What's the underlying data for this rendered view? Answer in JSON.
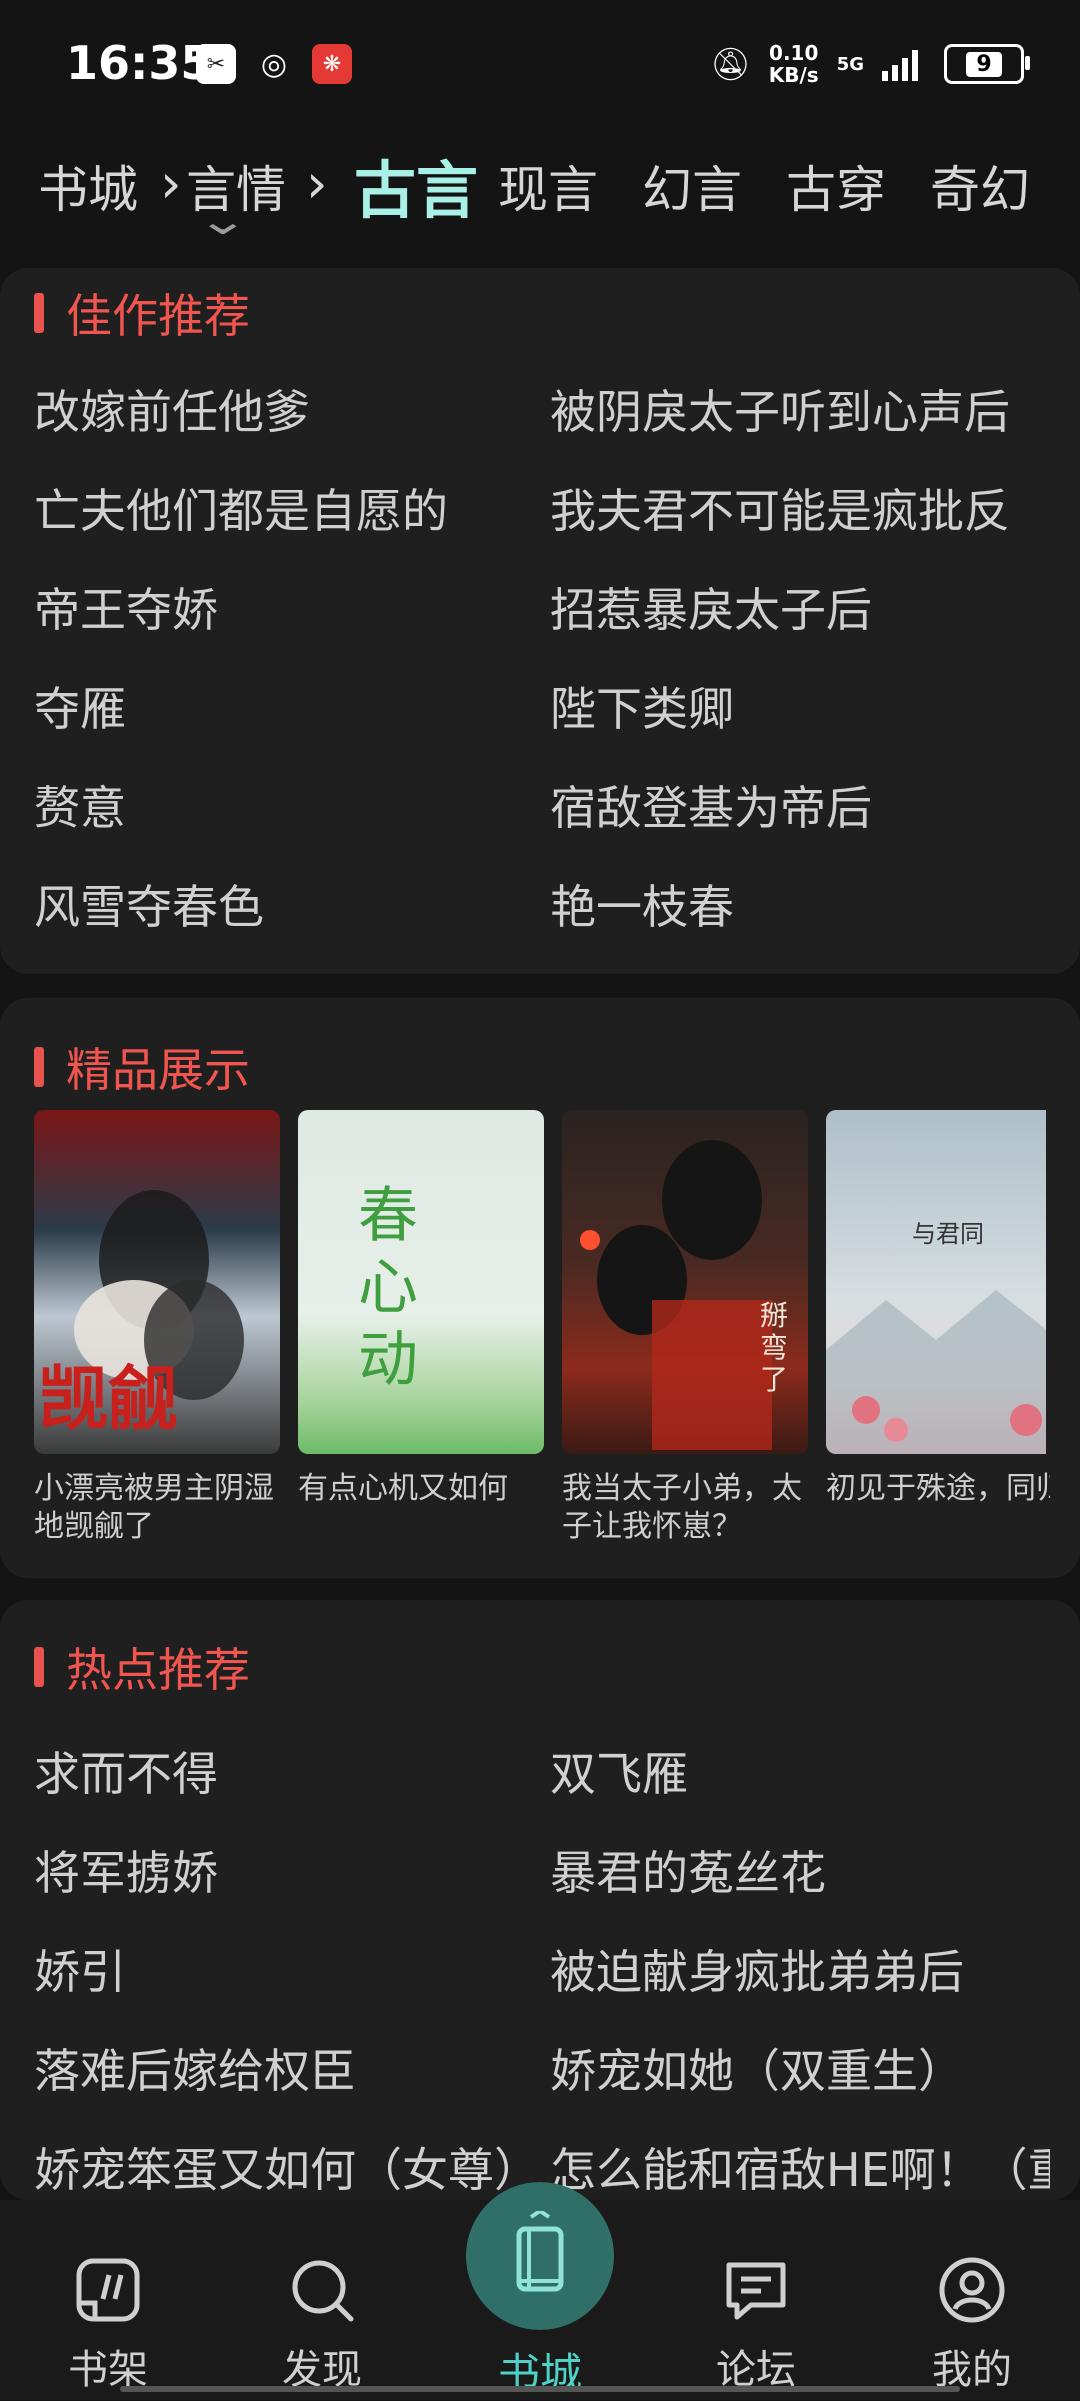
{
  "status_bar": {
    "time": "16:35",
    "net_speed_value": "0.10",
    "net_speed_unit": "KB/s",
    "network": "5G",
    "battery": "9"
  },
  "category_tabs": [
    {
      "label": "书城"
    },
    {
      "label": "言情"
    },
    {
      "label": "古言",
      "active": true
    },
    {
      "label": "现言"
    },
    {
      "label": "幻言"
    },
    {
      "label": "古穿"
    },
    {
      "label": "奇幻"
    }
  ],
  "sections": {
    "featured": {
      "title": "佳作推荐",
      "items": [
        "改嫁前任他爹",
        "被阴戾太子听到心声后",
        "亡夫他们都是自愿的",
        "我夫君不可能是疯批反",
        "帝王夺娇",
        "招惹暴戾太子后",
        "夺雁",
        "陛下类卿",
        "赘意",
        "宿敌登基为帝后",
        "风雪夺春色",
        "艳一枝春"
      ]
    },
    "premium": {
      "title": "精品展示",
      "books": [
        {
          "title": "小漂亮被男主阴湿地觊觎了",
          "cover_text": "觊觎"
        },
        {
          "title": "有点心机又如何",
          "cover_text": "春心动"
        },
        {
          "title": "我当太子小弟，太子让我怀崽？",
          "cover_text": "掰弯了"
        },
        {
          "title": "初见于殊途，同归以终老。",
          "cover_text": "与君同"
        }
      ]
    },
    "hot": {
      "title": "热点推荐",
      "items": [
        "求而不得",
        "双飞雁",
        "将军掳娇",
        "暴君的菟丝花",
        "娇引",
        "被迫献身疯批弟弟后",
        "落难后嫁给权臣",
        "娇宠如她（双重生）",
        "娇宠笨蛋又如何（女尊）",
        "怎么能和宿敌HE啊！（重"
      ]
    }
  },
  "bottom_nav": {
    "items": [
      {
        "label": "书架",
        "icon": "bookshelf-icon"
      },
      {
        "label": "发现",
        "icon": "search-icon"
      },
      {
        "label": "书城",
        "icon": "book-icon",
        "active": true
      },
      {
        "label": "论坛",
        "icon": "chat-icon"
      },
      {
        "label": "我的",
        "icon": "user-icon"
      }
    ]
  },
  "colors": {
    "accent": "#4fd1c5",
    "section_title": "#f0564f",
    "active_tab": "#a9f0e6"
  }
}
